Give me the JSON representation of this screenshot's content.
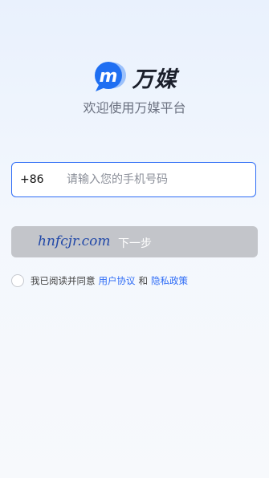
{
  "brand": {
    "name": "万媒",
    "tagline": "欢迎使用万媒平台",
    "logo_glyph": "m",
    "colors": {
      "accent": "#2f6df6",
      "logo_blue": "#1f6ff2",
      "logo_light": "#9cc1fb"
    }
  },
  "login": {
    "country_code": "+86",
    "phone_placeholder": "请输入您的手机号码",
    "watermark": "hnfcjr.com",
    "next_label": "下一步"
  },
  "agreement": {
    "prefix": "我已阅读并同意",
    "user_agreement": "用户协议",
    "and": "和",
    "privacy_policy": "隐私政策"
  }
}
